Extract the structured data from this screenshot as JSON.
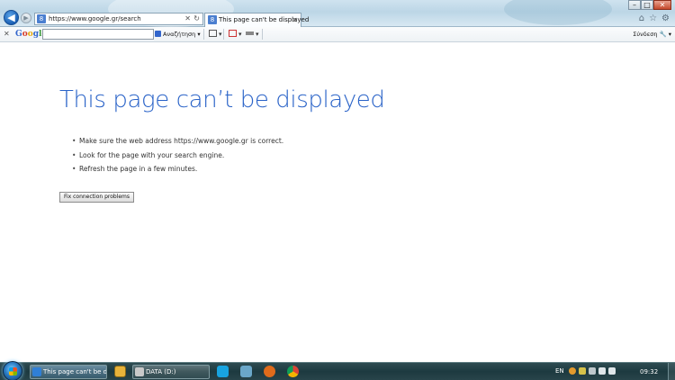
{
  "browser": {
    "address_url": "https://www.google.gr/search",
    "tab_title": "This page can't be displayed",
    "window_controls": {
      "minimize": "–",
      "maximize": "□",
      "close": "✕"
    }
  },
  "google_toolbar": {
    "logo": {
      "g1": "G",
      "o1": "o",
      "o2": "o",
      "g2": "g",
      "l": "l",
      "e": "e"
    },
    "search_value": "",
    "search_button_label": "Αναζήτηση",
    "signin_label": "Σύνδεση"
  },
  "page": {
    "title": "This page can’t be displayed",
    "bullets": [
      "Make sure the web address https://www.google.gr is correct.",
      "Look for the page with your search engine.",
      "Refresh the page in a few minutes."
    ],
    "fix_button_label": "Fix connection problems"
  },
  "taskbar": {
    "items": [
      {
        "label": "This page can't be di..."
      },
      {
        "label": "DATA (D:)"
      }
    ],
    "language": "EN",
    "clock": "09:32"
  },
  "colors": {
    "title_blue": "#2a63c8",
    "taskbar_bg": "#1d3a40"
  }
}
